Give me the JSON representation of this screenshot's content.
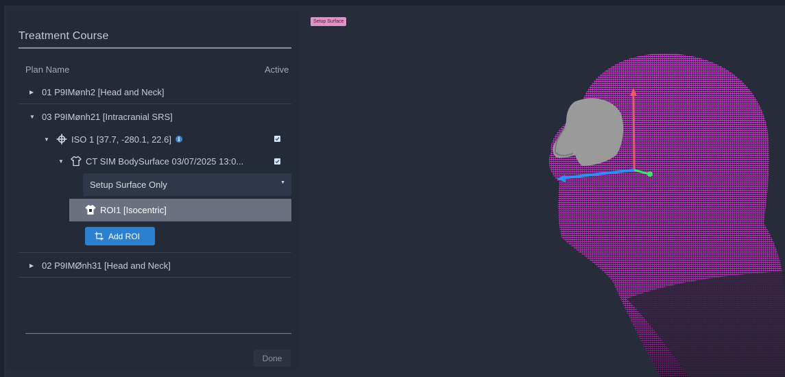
{
  "viewport": {
    "overlay_label": "Setup Surface"
  },
  "treatment_course": {
    "title": "Treatment Course",
    "columns": {
      "plan_name": "Plan Name",
      "active": "Active"
    },
    "plans": [
      {
        "label": "01 P9IMønh2 [Head and Neck]",
        "expanded": false
      },
      {
        "label": "03 P9IMønh21 [Intracranial SRS]",
        "expanded": true
      },
      {
        "label": "02 P9IMØnh31 [Head and Neck]",
        "expanded": false
      }
    ],
    "iso": {
      "label": "ISO 1 [37.7, -280.1, 22.6]",
      "active": true,
      "icon": "crosshair-icon"
    },
    "surface": {
      "label": "CT SIM BodySurface 03/07/2025 13:0...",
      "active": true,
      "icon": "body-outline-icon"
    },
    "surface_mode": {
      "selected": "Setup Surface Only"
    },
    "roi": {
      "label": "ROI1 [Isocentric]",
      "icon": "roi-torso-icon"
    },
    "add_roi_label": "Add ROI",
    "done_label": "Done"
  },
  "colors": {
    "accent": "#2b80d0",
    "point_cloud": "#d23ed0",
    "axis_x": "#2f8ef5",
    "axis_y": "#f2566a",
    "axis_z": "#3de46c",
    "tag": "#e68ec9"
  }
}
